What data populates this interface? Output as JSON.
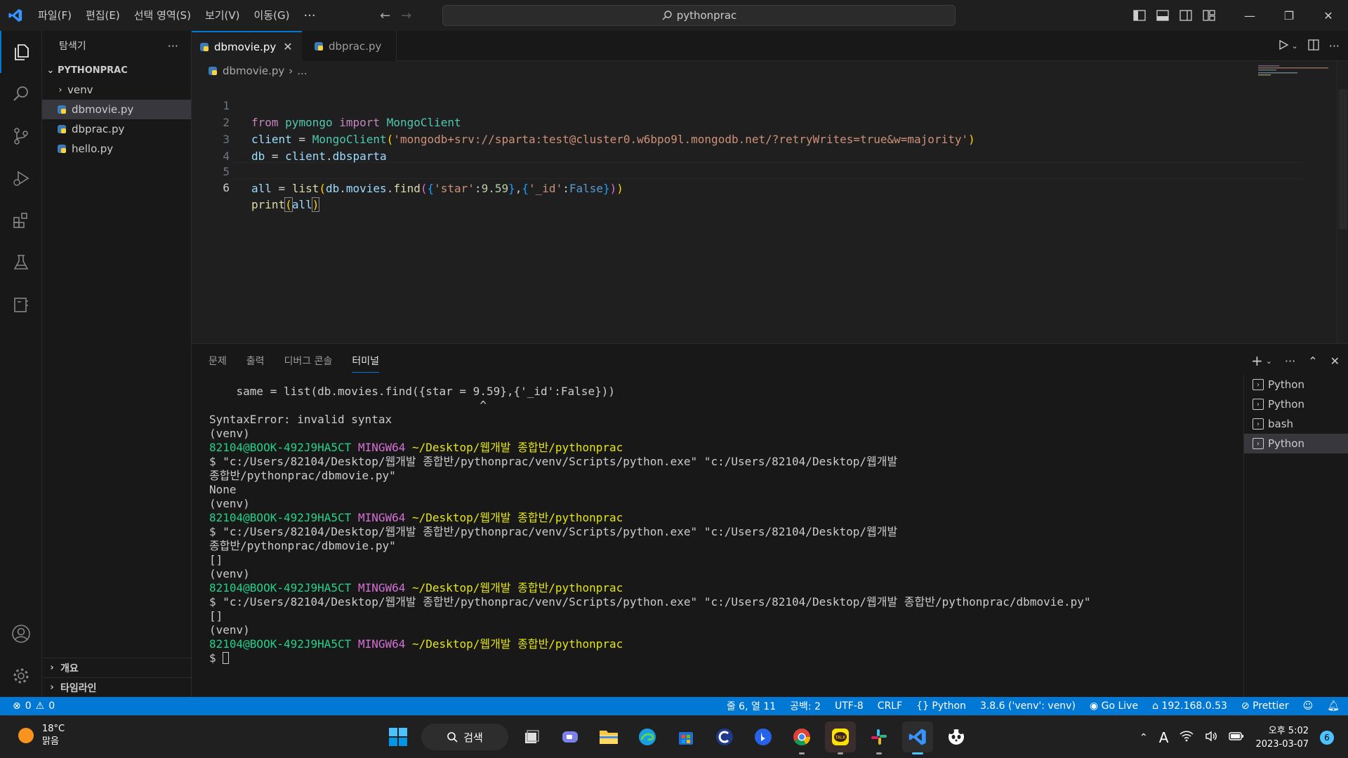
{
  "titlebar": {
    "menus": [
      "파일(F)",
      "편집(E)",
      "선택 영역(S)",
      "보기(V)",
      "이동(G)"
    ],
    "more": "···",
    "search_text": "pythonprac",
    "logo_icon": "vscode-icon"
  },
  "activitybar": {
    "icons": [
      "explorer-icon",
      "search-icon",
      "source-control-icon",
      "run-debug-icon",
      "extensions-icon",
      "testing-icon",
      "remote-explorer-icon",
      "account-icon",
      "settings-gear-icon"
    ]
  },
  "sidebar": {
    "title": "탐색기",
    "more": "···",
    "folder": "PYTHONPRAC",
    "items": [
      {
        "label": "venv",
        "type": "folder"
      },
      {
        "label": "dbmovie.py",
        "type": "file"
      },
      {
        "label": "dbprac.py",
        "type": "file"
      },
      {
        "label": "hello.py",
        "type": "file"
      }
    ],
    "sections": [
      "개요",
      "타임라인"
    ]
  },
  "tabs": [
    {
      "label": "dbmovie.py",
      "active": true
    },
    {
      "label": "dbprac.py",
      "active": false
    }
  ],
  "breadcrumb": {
    "file": "dbmovie.py",
    "rest": "..."
  },
  "editor": {
    "line_numbers": [
      "1",
      "2",
      "3",
      "4",
      "5",
      "6"
    ],
    "l1": {
      "a": "from",
      "b": "pymongo",
      "c": "import",
      "d": "MongoClient"
    },
    "l2": {
      "a": "client",
      "b": " = ",
      "c": "MongoClient",
      "d": "(",
      "e": "'mongodb+srv://sparta:test@cluster0.w6bpo9l.mongodb.net/?retryWrites=true&w=majority'",
      "f": ")"
    },
    "l3": {
      "a": "db",
      "b": " = ",
      "c": "client",
      "d": ".",
      "e": "dbsparta"
    },
    "l5": {
      "a": "all",
      "b": " = ",
      "c": "list",
      "d": "(",
      "e": "db",
      "f": ".",
      "g": "movies",
      "h": ".",
      "i": "find",
      "j": "(",
      "k": "{",
      "l": "'star'",
      "m": ":",
      "n": "9.59",
      "o": "}",
      "p": ",",
      "q": "{",
      "r": "'_id'",
      "s": ":",
      "t": "False",
      "u": "}",
      "v": ")",
      "w": ")"
    },
    "l6": {
      "a": "print",
      "b": "(",
      "c": "all",
      "d": ")"
    }
  },
  "panel": {
    "tabs": [
      "문제",
      "출력",
      "디버그 콘솔",
      "터미널"
    ],
    "active_tab": "터미널",
    "terminal_lines": [
      {
        "t": "    same = list(db.movies.find({star = 9.59},{'_id':False}))"
      },
      {
        "t": "                                        ^"
      },
      {
        "t": "SyntaxError: invalid syntax"
      },
      {
        "t": "(venv)"
      },
      {
        "prompt": true,
        "user": "82104@BOOK-492J9HA5CT",
        "sys": "MINGW64",
        "path": "~/Desktop/웹개발 종합반/pythonprac"
      },
      {
        "t": "$ \"c:/Users/82104/Desktop/웹개발 종합반/pythonprac/venv/Scripts/python.exe\" \"c:/Users/82104/Desktop/웹개발"
      },
      {
        "t": "종합반/pythonprac/dbmovie.py\""
      },
      {
        "t": "None"
      },
      {
        "t": "(venv)"
      },
      {
        "prompt": true,
        "user": "82104@BOOK-492J9HA5CT",
        "sys": "MINGW64",
        "path": "~/Desktop/웹개발 종합반/pythonprac"
      },
      {
        "t": "$ \"c:/Users/82104/Desktop/웹개발 종합반/pythonprac/venv/Scripts/python.exe\" \"c:/Users/82104/Desktop/웹개발"
      },
      {
        "t": "종합반/pythonprac/dbmovie.py\""
      },
      {
        "t": "[]"
      },
      {
        "t": "(venv)"
      },
      {
        "prompt": true,
        "user": "82104@BOOK-492J9HA5CT",
        "sys": "MINGW64",
        "path": "~/Desktop/웹개발 종합반/pythonprac"
      },
      {
        "t": "$ \"c:/Users/82104/Desktop/웹개발 종합반/pythonprac/venv/Scripts/python.exe\" \"c:/Users/82104/Desktop/웹개발 종합반/pythonprac/dbmovie.py\""
      },
      {
        "t": "[]"
      },
      {
        "t": "(venv)"
      },
      {
        "prompt": true,
        "user": "82104@BOOK-492J9HA5CT",
        "sys": "MINGW64",
        "path": "~/Desktop/웹개발 종합반/pythonprac"
      },
      {
        "cursor": true,
        "t": "$ "
      }
    ],
    "terminals": [
      {
        "label": "Python",
        "selected": false
      },
      {
        "label": "Python",
        "selected": false
      },
      {
        "label": "bash",
        "selected": false
      },
      {
        "label": "Python",
        "selected": true
      }
    ]
  },
  "statusbar": {
    "errors": "0",
    "warnings": "0",
    "position": "줄 6, 열 11",
    "spaces": "공백: 2",
    "encoding": "UTF-8",
    "eol": "CRLF",
    "language": "Python",
    "interpreter": "3.8.6 ('venv': venv)",
    "golive": "Go Live",
    "ip": "192.168.0.53",
    "prettier": "Prettier"
  },
  "taskbar": {
    "temperature": "18°C",
    "condition": "맑음",
    "search_label": "검색",
    "time": "오후 5:02",
    "date": "2023-03-07",
    "notifications": "6",
    "ime": "A"
  },
  "colors": {
    "accent": "#0078d4",
    "statusbar": "#0078d4"
  }
}
